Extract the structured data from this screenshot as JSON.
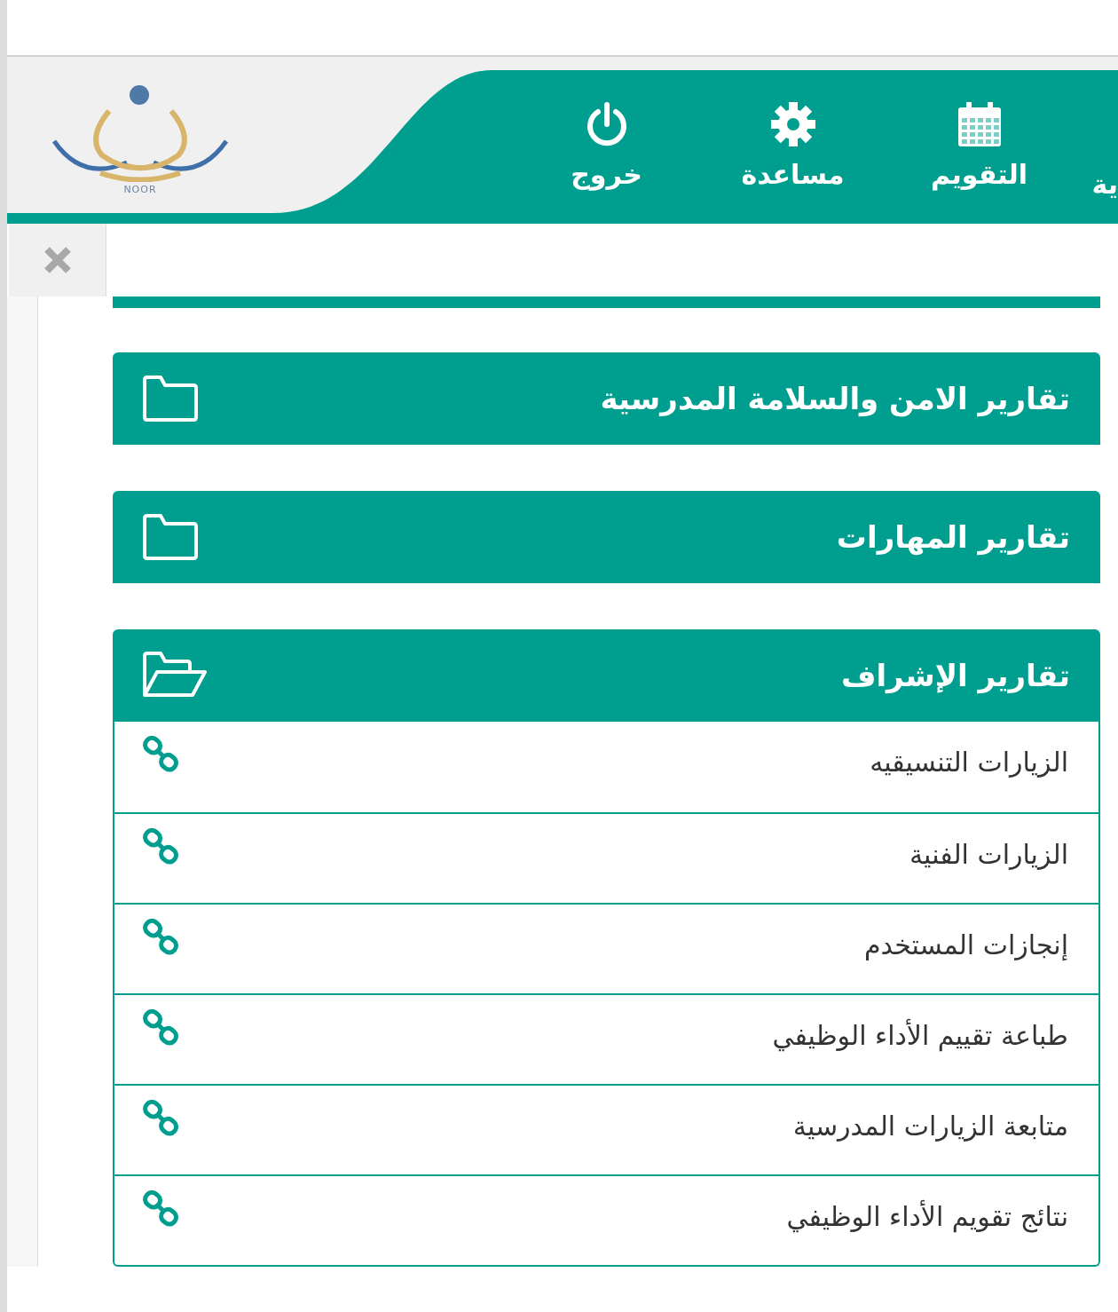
{
  "logo": {
    "text": "NOOR"
  },
  "nav": [
    {
      "label": "ية",
      "kind": "text"
    },
    {
      "label": "التقويم",
      "kind": "calendar"
    },
    {
      "label": "مساعدة",
      "kind": "help"
    },
    {
      "label": "خروج",
      "kind": "logout"
    }
  ],
  "panels": [
    {
      "title": "تقارير الامن والسلامة المدرسية",
      "expanded": false
    },
    {
      "title": "تقارير المهارات",
      "expanded": false
    },
    {
      "title": "تقارير الإشراف",
      "expanded": true,
      "items": [
        {
          "label": "الزيارات التنسيقيه"
        },
        {
          "label": "الزيارات الفنية"
        },
        {
          "label": "إنجازات المستخدم"
        },
        {
          "label": "طباعة تقييم الأداء الوظيفي"
        },
        {
          "label": "متابعة الزيارات المدرسية"
        },
        {
          "label": "نتائج تقويم الأداء الوظيفي"
        }
      ]
    }
  ]
}
